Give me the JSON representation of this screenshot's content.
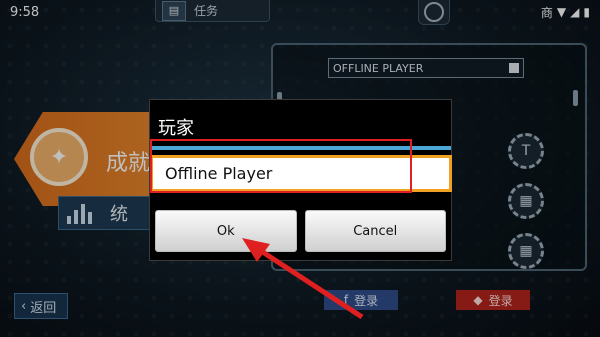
{
  "status_bar": {
    "time": "9:58",
    "status_text": "商"
  },
  "top_bar": {
    "tasks_label": "任务"
  },
  "left_panel": {
    "achievements_label": "成就",
    "stats_label": "统"
  },
  "right_panel": {
    "player_name_bar": "OFFLINE PLAYER"
  },
  "bottom": {
    "back_label": "返回",
    "login_label_1": "登录",
    "login_label_2": "登录"
  },
  "dialog": {
    "title": "玩家",
    "input_value": "Offline Player",
    "ok_label": "Ok",
    "cancel_label": "Cancel"
  },
  "colors": {
    "accent_orange": "#e9892d",
    "dialog_divider": "#4aa7d6",
    "highlight_red": "#e02020"
  }
}
